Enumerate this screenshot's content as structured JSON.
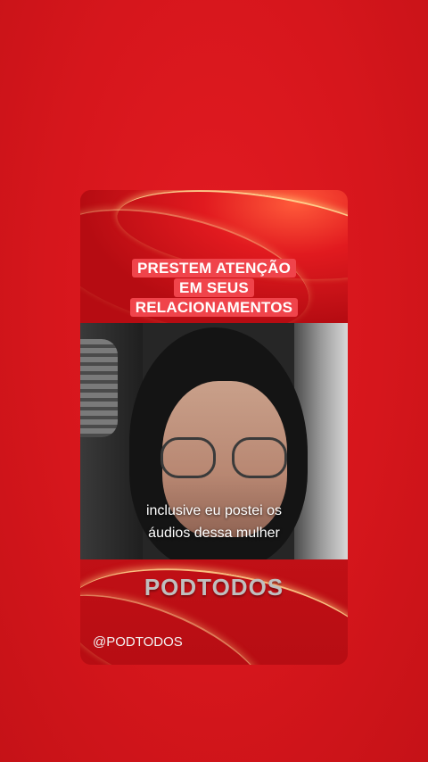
{
  "post": {
    "headline_lines": [
      "PRESTEM ATENÇÃO",
      "EM SEUS",
      "RELACIONAMENTOS"
    ],
    "caption_lines": [
      "inclusive eu postei os",
      "áudios dessa mulher"
    ],
    "brand": "PODTODOS",
    "handle": "@PODTODOS"
  },
  "colors": {
    "background": "#d8151b",
    "headline_highlight": "#f0444b",
    "brand_text": "#bfbfbf"
  }
}
